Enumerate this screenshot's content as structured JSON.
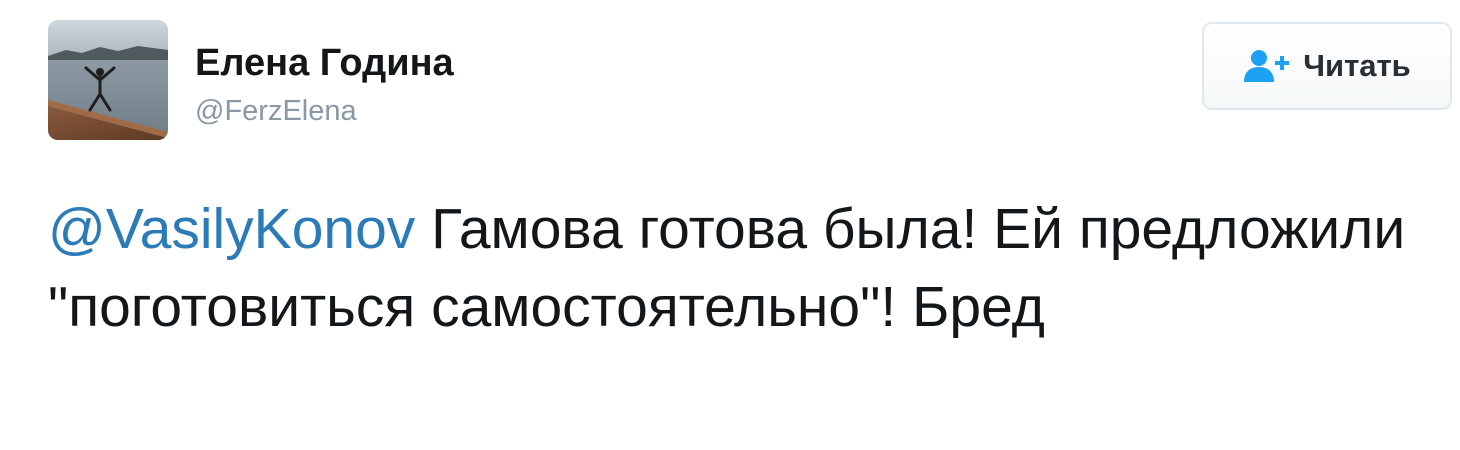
{
  "user": {
    "display_name": "Елена Година",
    "handle": "@FerzElena"
  },
  "follow_button": {
    "label": "Читать",
    "icon": "add-user-icon"
  },
  "tweet": {
    "mention": "@VasilyKonov",
    "text": " Гамова готова была! Ей предложили \"поготовиться самостоятельно\"! Бред"
  },
  "colors": {
    "mention": "#2b7bb9",
    "handle": "#8899a6",
    "follow_icon": "#1da1f2"
  }
}
